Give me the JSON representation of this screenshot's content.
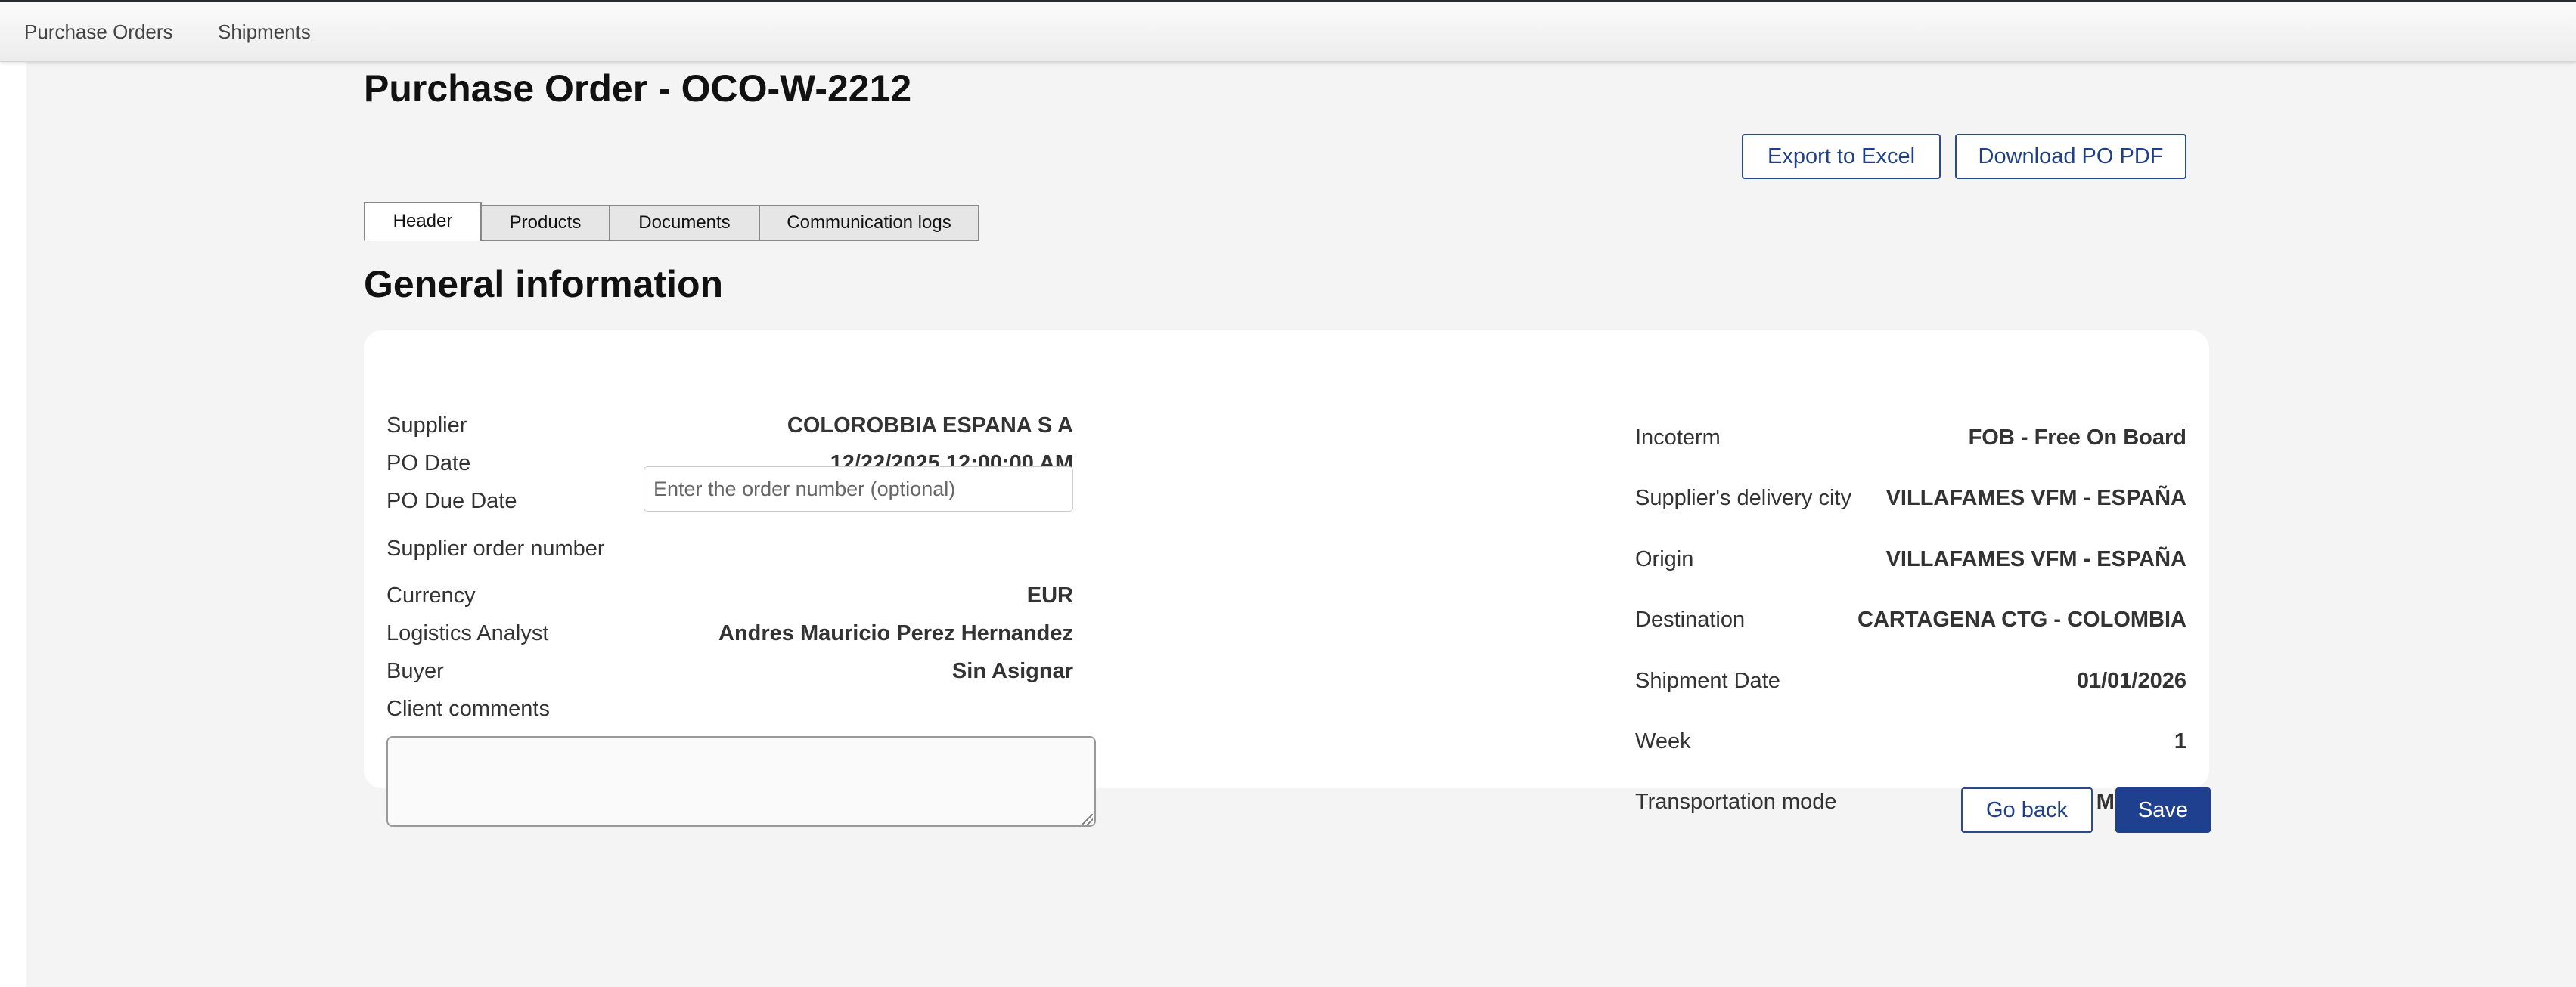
{
  "nav": {
    "items": [
      {
        "label": "Purchase Orders"
      },
      {
        "label": "Shipments"
      }
    ]
  },
  "page": {
    "title": "Purchase Order - OCO-W-2212"
  },
  "actions": {
    "export_label": "Export to Excel",
    "pdf_label": "Download PO PDF",
    "go_back_label": "Go back",
    "save_label": "Save"
  },
  "tabs": [
    {
      "label": "Header",
      "active": true
    },
    {
      "label": "Products",
      "active": false
    },
    {
      "label": "Documents",
      "active": false
    },
    {
      "label": "Communication logs",
      "active": false
    }
  ],
  "general": {
    "title": "General information",
    "left": {
      "supplier_label": "Supplier",
      "supplier_value": "COLOROBBIA ESPANA S A",
      "po_date_label": "PO Date",
      "po_date_value": "12/22/2025 12:00:00 AM",
      "po_due_date_label": "PO Due Date",
      "po_due_date_value": "",
      "order_number_label": "Supplier order number",
      "order_number_value": "",
      "order_number_placeholder": "Enter the order number (optional)",
      "currency_label": "Currency",
      "currency_value": "EUR",
      "analyst_label": "Logistics Analyst",
      "analyst_value": "Andres Mauricio Perez Hernandez",
      "buyer_label": "Buyer",
      "buyer_value": "Sin Asignar",
      "comments_label": "Client comments",
      "comments_value": ""
    },
    "right": {
      "incoterm_label": "Incoterm",
      "incoterm_value": "FOB - Free On Board",
      "delivery_city_label": "Supplier's delivery city",
      "delivery_city_value": "VILLAFAMES VFM - ESPAÑA",
      "origin_label": "Origin",
      "origin_value": "VILLAFAMES VFM - ESPAÑA",
      "destination_label": "Destination",
      "destination_value": "CARTAGENA CTG - COLOMBIA",
      "shipment_date_label": "Shipment Date",
      "shipment_date_value": "01/01/2026",
      "week_label": "Week",
      "week_value": "1",
      "transport_label": "Transportation mode",
      "transport_value": "Maritime"
    }
  },
  "colors": {
    "accent": "#1f3f8f",
    "page_bg": "#f4f4f4",
    "card_bg": "#ffffff"
  }
}
